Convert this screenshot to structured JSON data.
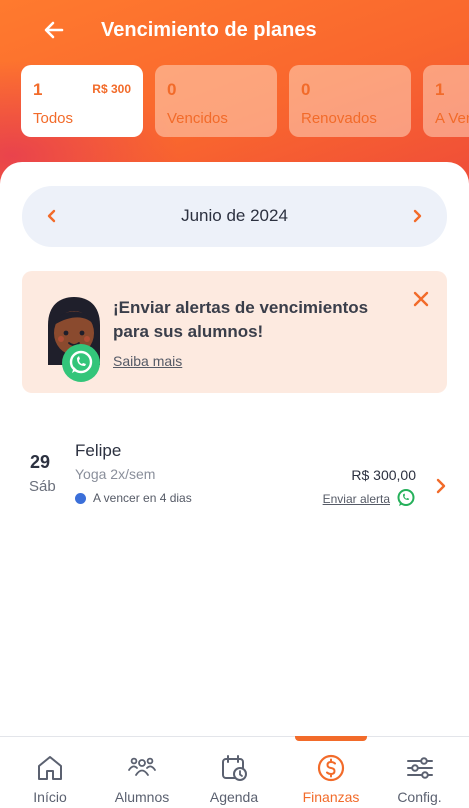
{
  "header": {
    "title": "Vencimiento de planes"
  },
  "filters": [
    {
      "count": "1",
      "label": "Todos",
      "amount": "R$ 300",
      "active": true
    },
    {
      "count": "0",
      "label": "Vencidos",
      "amount": "",
      "active": false
    },
    {
      "count": "0",
      "label": "Renovados",
      "amount": "",
      "active": false
    },
    {
      "count": "1",
      "label": "A Vencer",
      "amount": "",
      "active": false
    }
  ],
  "month": {
    "label": "Junio de 2024"
  },
  "alert_banner": {
    "title": "¡Enviar alertas de vencimientos para sus alumnos!",
    "link": "Saiba mais"
  },
  "plans": [
    {
      "day": "29",
      "weekday": "Sáb",
      "student": "Felipe",
      "plan": "Yoga 2x/sem",
      "status": "A vencer en 4 dias",
      "status_color": "#3b6fd9",
      "amount": "R$ 300,00",
      "action": "Enviar alerta"
    }
  ],
  "nav": [
    {
      "label": "Início",
      "icon": "home-icon",
      "active": false
    },
    {
      "label": "Alumnos",
      "icon": "users-icon",
      "active": false
    },
    {
      "label": "Agenda",
      "icon": "calendar-clock-icon",
      "active": false
    },
    {
      "label": "Finanzas",
      "icon": "dollar-circle-icon",
      "active": true
    },
    {
      "label": "Config.",
      "icon": "sliders-icon",
      "active": false
    }
  ],
  "colors": {
    "accent": "#f26b2a",
    "whatsapp": "#25d366",
    "banner_bg": "#fdeae0",
    "month_bg": "#edf1f9"
  }
}
